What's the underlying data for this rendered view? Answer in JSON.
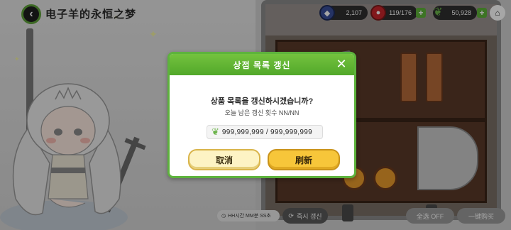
{
  "header": {
    "back_icon": "chevron-left-icon",
    "title": "电子羊的永恒之梦"
  },
  "currencies": [
    {
      "icon": "blue-gem-icon",
      "value": "2,107",
      "color": "#3a4f9a"
    },
    {
      "icon": "red-heart-gem-icon",
      "value": "119/176",
      "color": "#c8262b"
    },
    {
      "icon": "green-leaf-icon",
      "value": "50,928",
      "color": "#6bb34a"
    }
  ],
  "home_icon": "home-icon",
  "bottom_bar": {
    "timer_label": "HH시간 MM분 SS초",
    "refresh_now_label": "즉시 갱신",
    "select_all_label": "全选 OFF",
    "one_click_buy_label": "一键购买"
  },
  "dialog": {
    "title": "상점 목록 갱신",
    "question": "상품 목록을 갱신하시겠습니까?",
    "remaining": "오늘 남은 갱신 횟수 NN/NN",
    "cost_icon": "green-leaf-icon",
    "cost": "999,999,999 / 999,999,999",
    "cancel_label": "取消",
    "confirm_label": "刷新"
  },
  "colors": {
    "accent_green": "#5db33c",
    "confirm_yellow": "#f7c63a",
    "cancel_cream": "#fdf3c4"
  }
}
